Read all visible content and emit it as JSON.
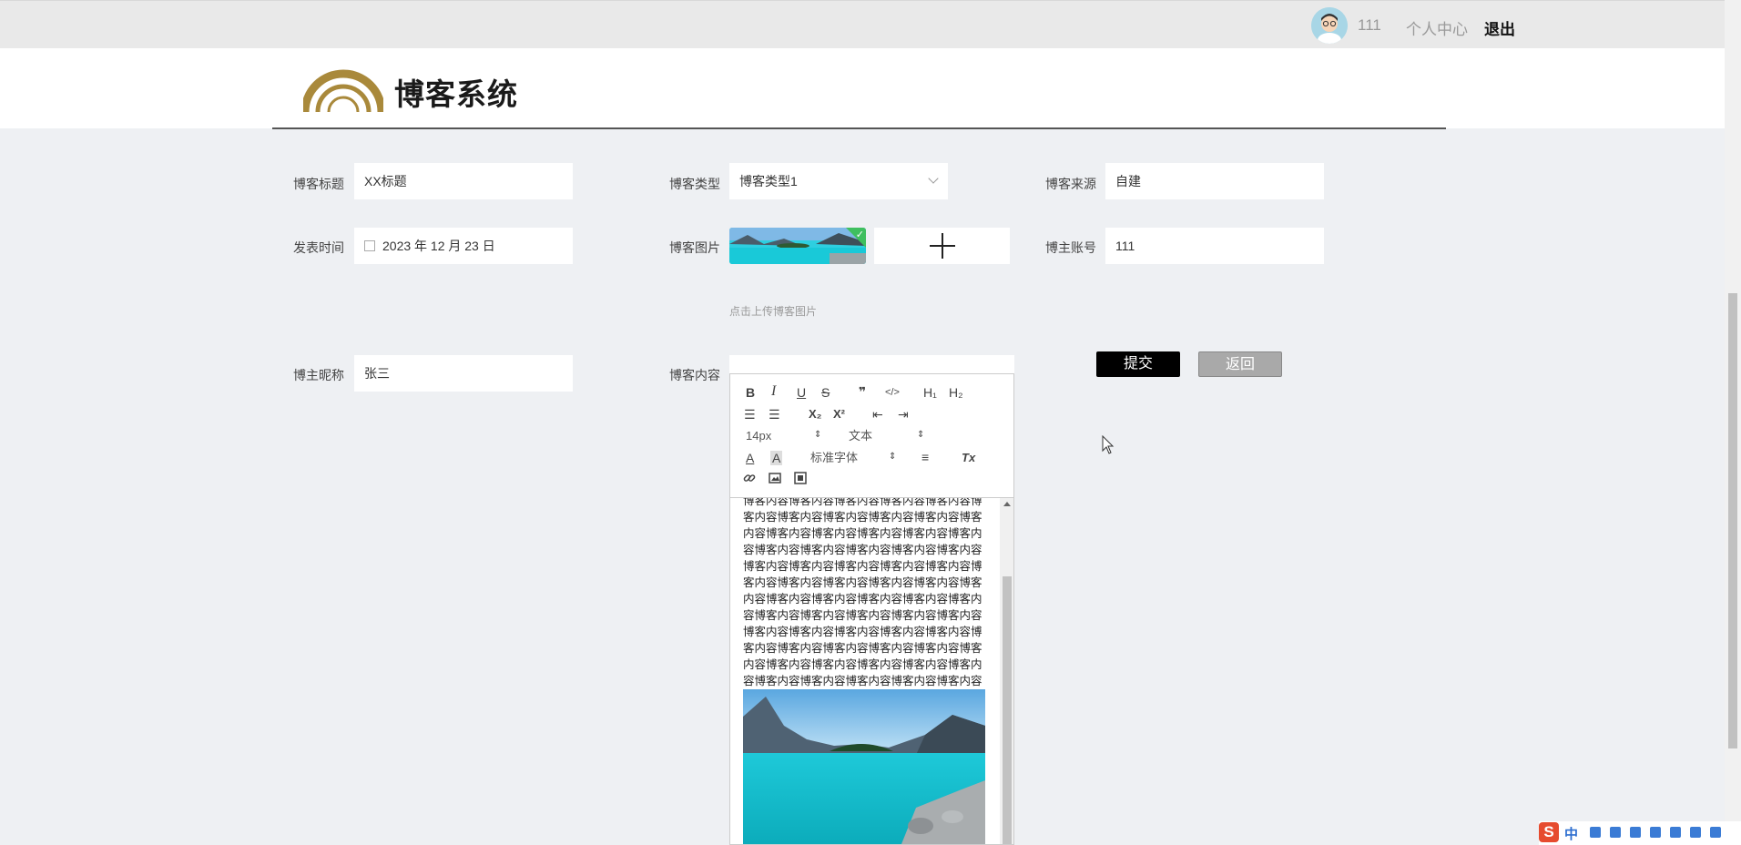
{
  "topbar": {
    "username": "111",
    "center_link": "个人中心",
    "logout": "退出"
  },
  "header": {
    "site_name": "博客系统"
  },
  "form": {
    "title_label": "博客标题",
    "title_value": "XX标题",
    "type_label": "博客类型",
    "type_value": "博客类型1",
    "source_label": "博客来源",
    "source_value": "自建",
    "time_label": "发表时间",
    "time_value": "2023 年 12 月 23 日",
    "image_label": "博客图片",
    "image_hint": "点击上传博客图片",
    "account_label": "博主账号",
    "account_value": "111",
    "nickname_label": "博主昵称",
    "nickname_value": "张三",
    "content_label": "博客内容"
  },
  "buttons": {
    "submit": "提交",
    "back": "返回"
  },
  "editor": {
    "toolbar": {
      "bold": "B",
      "italic": "I",
      "underline": "U",
      "strike": "S",
      "quote": "❞",
      "code": "</>",
      "h1": "H₁",
      "h2": "H₂",
      "ordered_list": "☰",
      "bullet_list": "☰",
      "subscript": "X₂",
      "superscript": "X²",
      "outdent": "⇤",
      "indent": "⇥",
      "size": "14px",
      "format": "文本",
      "font_color": "A",
      "bg_color": "A",
      "font_family": "标准字体",
      "align": "≡",
      "clean": "Tx"
    },
    "content_text": "博客内容博客内容博客内容博客内容博客内容博客内容博客内容博客内容博客内容博客内容博客内容博客内容博客内容博客内容博客内容博客内容博客内容博客内容博客内容博客内容博客内容博客内容博客内容博客内容博客内容博客内容博客内容博客内容博客内容博客内容博客内容博客内容博客内容博客内容博客内容博客内容博客内容博客内容博客内容博客内容博客内容博客内容博客内容博客内容博客内容博客内容博客内容博客内容博客内容博客内容博客内容博客内容博客内容博客内容博客内容博客内容博客内容博客内容博客内容博客内容博客内容博客内容博客内容博客内容博客内容博客内容博客内容博客内容博客内容博客内容博客内容博客内容博客内容博客内容博客内容博客内容博客内容博客内容博客内容博客内容博客内容博客内容博客内容博客内容博客内容博客内容博客内容博客内容博客内容博客内容博客内容博客内容博客内容博客内容博客内容博客内容博客内容博客内容博客内容博客内容博客内容博客内容博客内容博客内容博客内容博客内容"
  },
  "ime": {
    "logo": "S",
    "mode": "中"
  }
}
